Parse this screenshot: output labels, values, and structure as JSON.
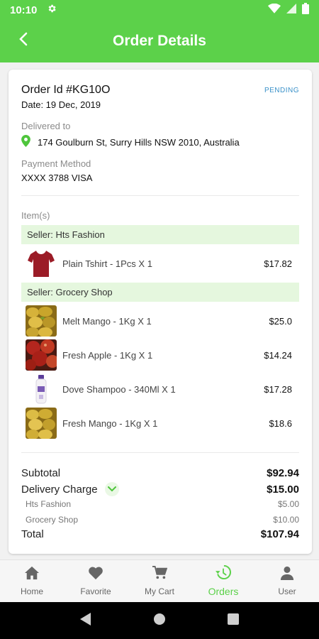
{
  "status_bar": {
    "time": "10:10"
  },
  "header": {
    "title": "Order Details"
  },
  "order": {
    "id_text": "Order Id #KG10O",
    "status": "PENDING",
    "date": "Date: 19 Dec, 2019",
    "delivered_label": "Delivered to",
    "address": "174 Goulburn St, Surry Hills NSW 2010, Australia",
    "payment_label": "Payment Method",
    "payment_value": "XXXX 3788 VISA",
    "items_label": "Item(s)"
  },
  "sellers": [
    {
      "name": "Seller: Hts Fashion",
      "items": [
        {
          "name": "Plain Tshirt - 1Pcs X 1",
          "price": "$17.82",
          "image": "tshirt-image"
        }
      ]
    },
    {
      "name": "Seller: Grocery Shop",
      "items": [
        {
          "name": "Melt Mango - 1Kg X 1",
          "price": "$25.0",
          "image": "mango-image"
        },
        {
          "name": "Fresh Apple - 1Kg X 1",
          "price": "$14.24",
          "image": "apple-image"
        },
        {
          "name": "Dove Shampoo - 340Ml X 1",
          "price": "$17.28",
          "image": "shampoo-image"
        },
        {
          "name": "Fresh Mango - 1Kg X 1",
          "price": "$18.6",
          "image": "mango-image"
        }
      ]
    }
  ],
  "summary": {
    "subtotal_label": "Subtotal",
    "subtotal": "$92.94",
    "delivery_label": "Delivery Charge",
    "delivery": "$15.00",
    "breakdown": [
      {
        "label": "Hts Fashion",
        "value": "$5.00"
      },
      {
        "label": "Grocery Shop",
        "value": "$10.00"
      }
    ],
    "total_label": "Total",
    "total": "$107.94"
  },
  "bottom_nav": [
    {
      "label": "Home",
      "icon": "home-icon"
    },
    {
      "label": "Favorite",
      "icon": "heart-icon"
    },
    {
      "label": "My Cart",
      "icon": "cart-icon"
    },
    {
      "label": "Orders",
      "icon": "history-icon",
      "active": true
    },
    {
      "label": "User",
      "icon": "user-icon"
    }
  ],
  "colors": {
    "brand": "#5cd14a",
    "status": "#3a91c9",
    "seller_bg": "#e5f7de"
  }
}
